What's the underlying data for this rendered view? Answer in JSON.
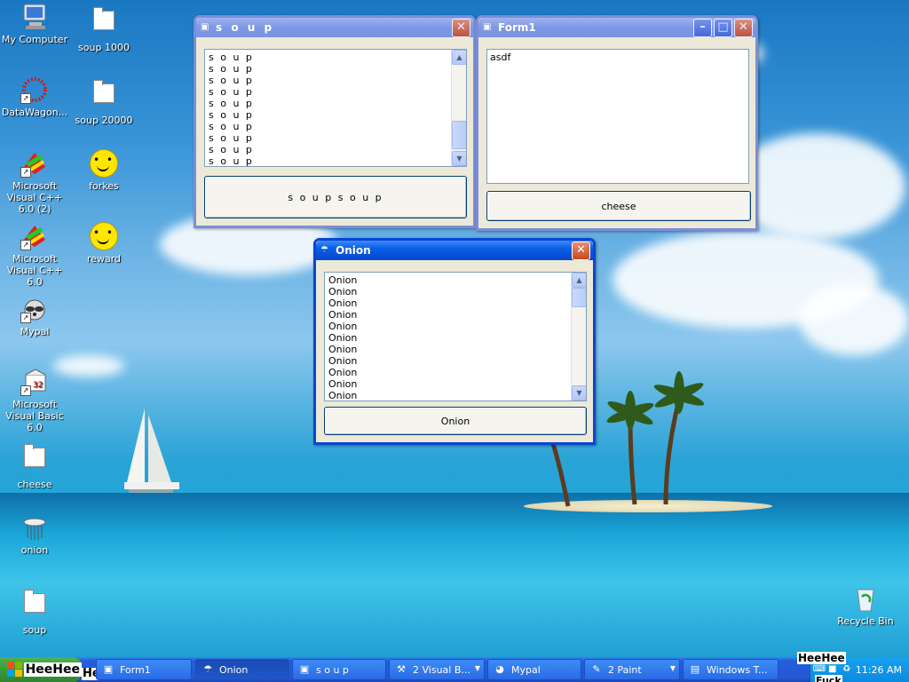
{
  "desktop_icons": [
    {
      "label": "My Computer",
      "icon": "computer-icon"
    },
    {
      "label": "soup 1000",
      "icon": "file-icon"
    },
    {
      "label": "DataWagon...",
      "icon": "datawagon-icon"
    },
    {
      "label": "soup 20000",
      "icon": "file-icon"
    },
    {
      "label": "Microsoft Visual C++ 6.0 (2)",
      "icon": "visual-cpp-icon"
    },
    {
      "label": "forkes",
      "icon": "smiley-icon"
    },
    {
      "label": "Microsoft Visual C++ 6.0",
      "icon": "visual-cpp-icon"
    },
    {
      "label": "reward",
      "icon": "smiley-icon"
    },
    {
      "label": "Mypal",
      "icon": "raccoon-icon"
    },
    {
      "label": "Microsoft Visual Basic 6.0",
      "icon": "visual-basic-icon"
    },
    {
      "label": "cheese",
      "icon": "file-icon"
    },
    {
      "label": "onion",
      "icon": "onion-icon"
    },
    {
      "label": "soup",
      "icon": "file-icon"
    },
    {
      "label": "Recycle Bin",
      "icon": "recycle-bin-icon"
    }
  ],
  "soup_window": {
    "title": "s o u p",
    "items": [
      "s o u p",
      "s o u p",
      "s o u p",
      "s o u p",
      "s o u p",
      "s o u p",
      "s o u p",
      "s o u p",
      "s o u p",
      "s o u p"
    ],
    "button": "s o u p s o u p"
  },
  "form1_window": {
    "title": "Form1",
    "text": "asdf",
    "button": "cheese"
  },
  "onion_window": {
    "title": "Onion",
    "items": [
      "Onion",
      "Onion",
      "Onion",
      "Onion",
      "Onion",
      "Onion",
      "Onion",
      "Onion",
      "Onion",
      "Onion",
      "Onion"
    ],
    "button": "Onion"
  },
  "taskbar": {
    "start_label": "HeeHee",
    "overlay_text": "He",
    "items": [
      {
        "label": "Form1",
        "icon": "window-icon"
      },
      {
        "label": "Onion",
        "icon": "onion-icon"
      },
      {
        "label": "s o u p",
        "icon": "window-icon"
      },
      {
        "label": "2 Visual B...",
        "icon": "visual-basic-icon"
      },
      {
        "label": "Mypal",
        "icon": "raccoon-icon"
      },
      {
        "label": "2 Paint",
        "icon": "paint-icon"
      },
      {
        "label": "Windows T...",
        "icon": "task-manager-icon"
      }
    ],
    "tray_overlay": "HeeHee",
    "tray_overlay2": "Fuck",
    "clock": "11:26 AM"
  },
  "colors": {
    "active_title": "#0a5fe8",
    "inactive_title": "#7f97e6",
    "taskbar": "#245edb",
    "start": "#3a9a3a"
  }
}
